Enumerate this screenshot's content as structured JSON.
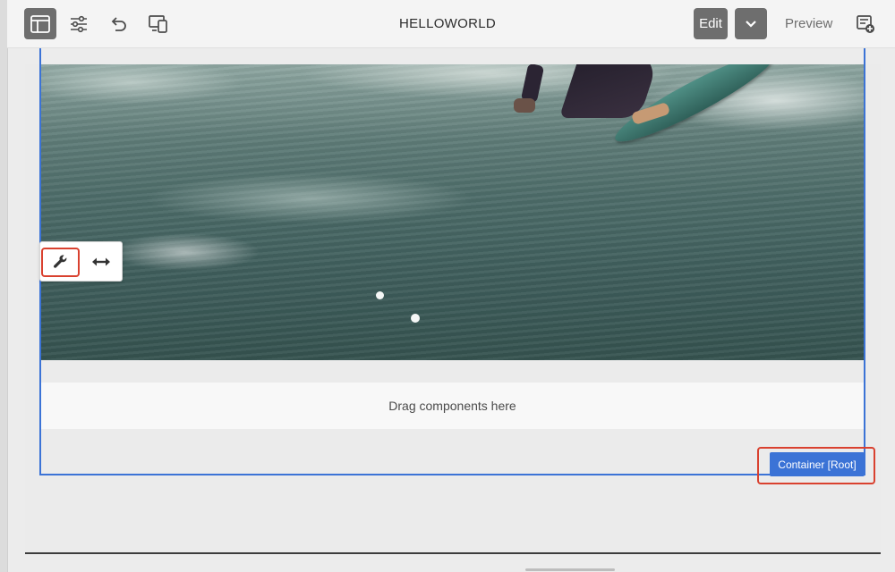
{
  "toolbar": {
    "title": "HELLOWORLD",
    "edit_label": "Edit",
    "preview_label": "Preview",
    "icons": [
      "toggle-side-panel-icon",
      "page-properties-icon",
      "undo-icon",
      "emulator-icon",
      "chevron-down-icon",
      "annotation-icon"
    ]
  },
  "canvas": {
    "dropzone_text": "Drag components here",
    "container_badge": "Container [Root]"
  },
  "component_toolbar": {
    "icons": [
      "wrench-icon",
      "resize-arrows-icon"
    ]
  },
  "colors": {
    "selection_blue": "#3b73d6",
    "highlight_red": "#d9412f",
    "toolbar_active": "#6e6e6e"
  }
}
